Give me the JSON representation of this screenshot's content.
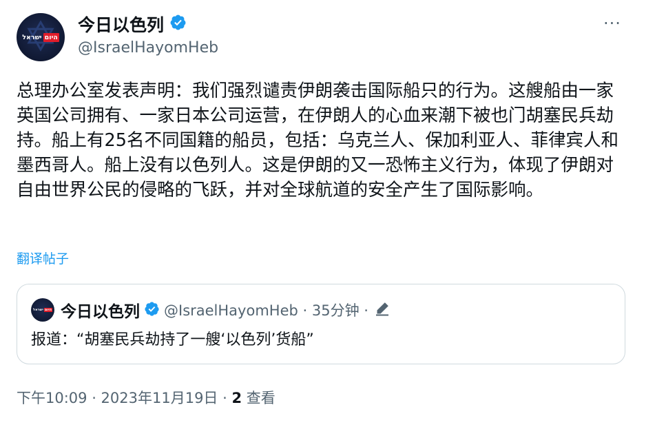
{
  "author": {
    "name": "今日以色列",
    "handle": "@IsraelHayomHeb",
    "avatar_logo_red": "היום",
    "avatar_logo_white": "ישראל"
  },
  "more_label": "···",
  "tweet": {
    "text": "总理办公室发表声明：我们强烈谴责伊朗袭击国际船只的行为。这艘船由一家英国公司拥有、一家日本公司运营，在伊朗人的心血来潮下被也门胡塞民兵劫持。船上有25名不同国籍的船员，包括：乌克兰人、保加利亚人、菲律宾人和墨西哥人。船上没有以色列人。这是伊朗的又一恐怖主义行为，体现了伊朗对自由世界公民的侵略的飞跃，并对全球航道的安全产生了国际影响。",
    "translate_label": "翻译帖子"
  },
  "quote": {
    "name": "今日以色列",
    "meta": "@IsraelHayomHeb · 35分钟 ·",
    "text": "报道：“胡塞民兵劫持了一艘‘以色列’货船”"
  },
  "footer": {
    "time": "下午10:09 · 2023年11月19日 · ",
    "views_count": "2",
    "views_label": " 查看"
  },
  "colors": {
    "verified_blue": "#1d9bf0",
    "link_blue": "#1d9bf0",
    "secondary_text": "#536471",
    "border": "#cfd9de"
  },
  "icons": [
    "verified-badge-icon",
    "more-options-icon",
    "edit-pencil-icon"
  ]
}
